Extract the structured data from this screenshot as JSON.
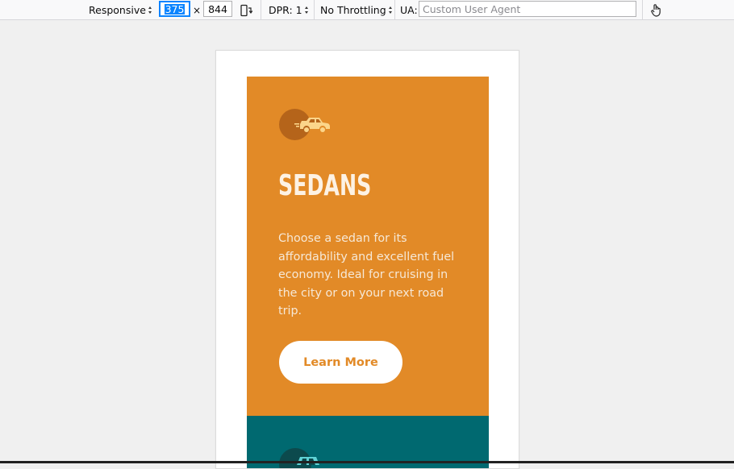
{
  "toolbar": {
    "device": "Responsive",
    "width": "375",
    "times": "×",
    "height": "844",
    "dpr": "DPR: 1",
    "throttling": "No Throttling",
    "ua_label": "UA:",
    "ua_placeholder": "Custom User Agent"
  },
  "card": {
    "title": "SEDANS",
    "description": "Choose a sedan for its affordability and excellent fuel economy. Ideal for cruising in the city or on your next road trip.",
    "button_label": "Learn More",
    "icon": "sedan-car-icon"
  },
  "next_card": {
    "icon": "suv-car-icon"
  },
  "colors": {
    "orange": "#e28a27",
    "teal": "#006970",
    "icon_circle": "#b5641a",
    "icon_car": "#fbd58a"
  }
}
